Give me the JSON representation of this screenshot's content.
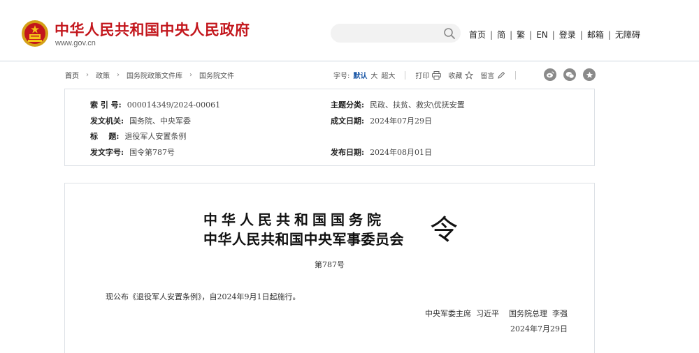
{
  "header": {
    "site_title": "中华人民共和国中央人民政府",
    "site_url": "www.gov.cn",
    "search": {
      "value": "",
      "placeholder": ""
    },
    "nav": [
      "首页",
      "简",
      "繁",
      "EN",
      "登录",
      "邮箱",
      "无障碍"
    ]
  },
  "breadcrumb": [
    "首页",
    "政策",
    "国务院政策文件库",
    "国务院文件"
  ],
  "tools": {
    "font_size_label": "字号:",
    "font_default": "默认",
    "font_large": "大",
    "font_xlarge": "超大",
    "print": "打印",
    "favorite": "收藏",
    "comment": "留言"
  },
  "share_icons": [
    "weibo-icon",
    "wechat-icon",
    "favorite-star-icon"
  ],
  "meta": {
    "index_label": "索 引 号:",
    "index_value": "000014349/2024-00061",
    "category_label": "主题分类:",
    "category_value": "民政、扶贫、救灾\\优抚安置",
    "issuer_label": "发文机关:",
    "issuer_value": "国务院、中央军委",
    "written_date_label": "成文日期:",
    "written_date_value": "2024年07月29日",
    "title_label": "标    题:",
    "title_value": "退役军人安置条例",
    "doc_no_label": "发文字号:",
    "doc_no_value": "国令第787号",
    "publish_date_label": "发布日期:",
    "publish_date_value": "2024年08月01日"
  },
  "document": {
    "title_line1": "中华人民共和国国务院",
    "title_line2": "中华人民共和国中央军事委员会",
    "ling": "令",
    "number": "第787号",
    "body": "现公布《退役军人安置条例》，自2024年9月1日起施行。",
    "signature": "中央军委主席  习近平    国务院总理  李强",
    "date": "2024年7月29日"
  },
  "colors": {
    "brand_red": "#c3161c",
    "link_blue": "#1a57a6"
  }
}
